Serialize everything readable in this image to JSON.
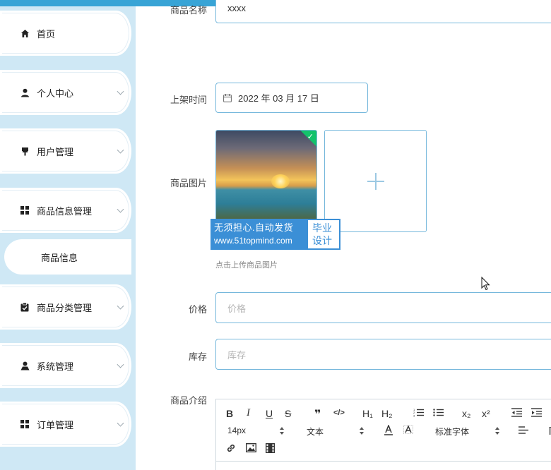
{
  "sidebar": {
    "items": [
      {
        "label": "首页",
        "icon": "home-icon"
      },
      {
        "label": "个人中心",
        "icon": "user-icon"
      },
      {
        "label": "用户管理",
        "icon": "user-manage-icon"
      },
      {
        "label": "商品信息管理",
        "icon": "grid-icon"
      },
      {
        "label": "商品分类管理",
        "icon": "clipboard-icon"
      },
      {
        "label": "系统管理",
        "icon": "person-icon"
      },
      {
        "label": "订单管理",
        "icon": "grid-icon"
      }
    ],
    "sub_item": "商品信息"
  },
  "form": {
    "name_label": "商品名称",
    "name_value": "xxxx",
    "date_label": "上架时间",
    "date_value": "2022 年 03 月 17 日",
    "image_label": "商品图片",
    "upload_tip": "点击上传商品图片",
    "price_label": "价格",
    "price_placeholder": "价格",
    "stock_label": "库存",
    "stock_placeholder": "库存",
    "intro_label": "商品介绍"
  },
  "watermark": {
    "line1": "无须担心.自动发货",
    "line2": "www.51topmind.com",
    "badge_line1": "毕业",
    "badge_line2": "设计"
  },
  "editor": {
    "font_size": "14px",
    "block_type": "文本",
    "font_family": "标准字体",
    "buttons": {
      "bold": "B",
      "italic": "I",
      "underline": "U",
      "strike": "S",
      "h1": "H₁",
      "h2": "H₂",
      "sub": "x₂",
      "sup": "x²"
    }
  },
  "colors": {
    "accent": "#38a4d6",
    "sidebar_bg": "#cfe8f5",
    "input_border": "#76b8dc",
    "success": "#13c26b"
  }
}
